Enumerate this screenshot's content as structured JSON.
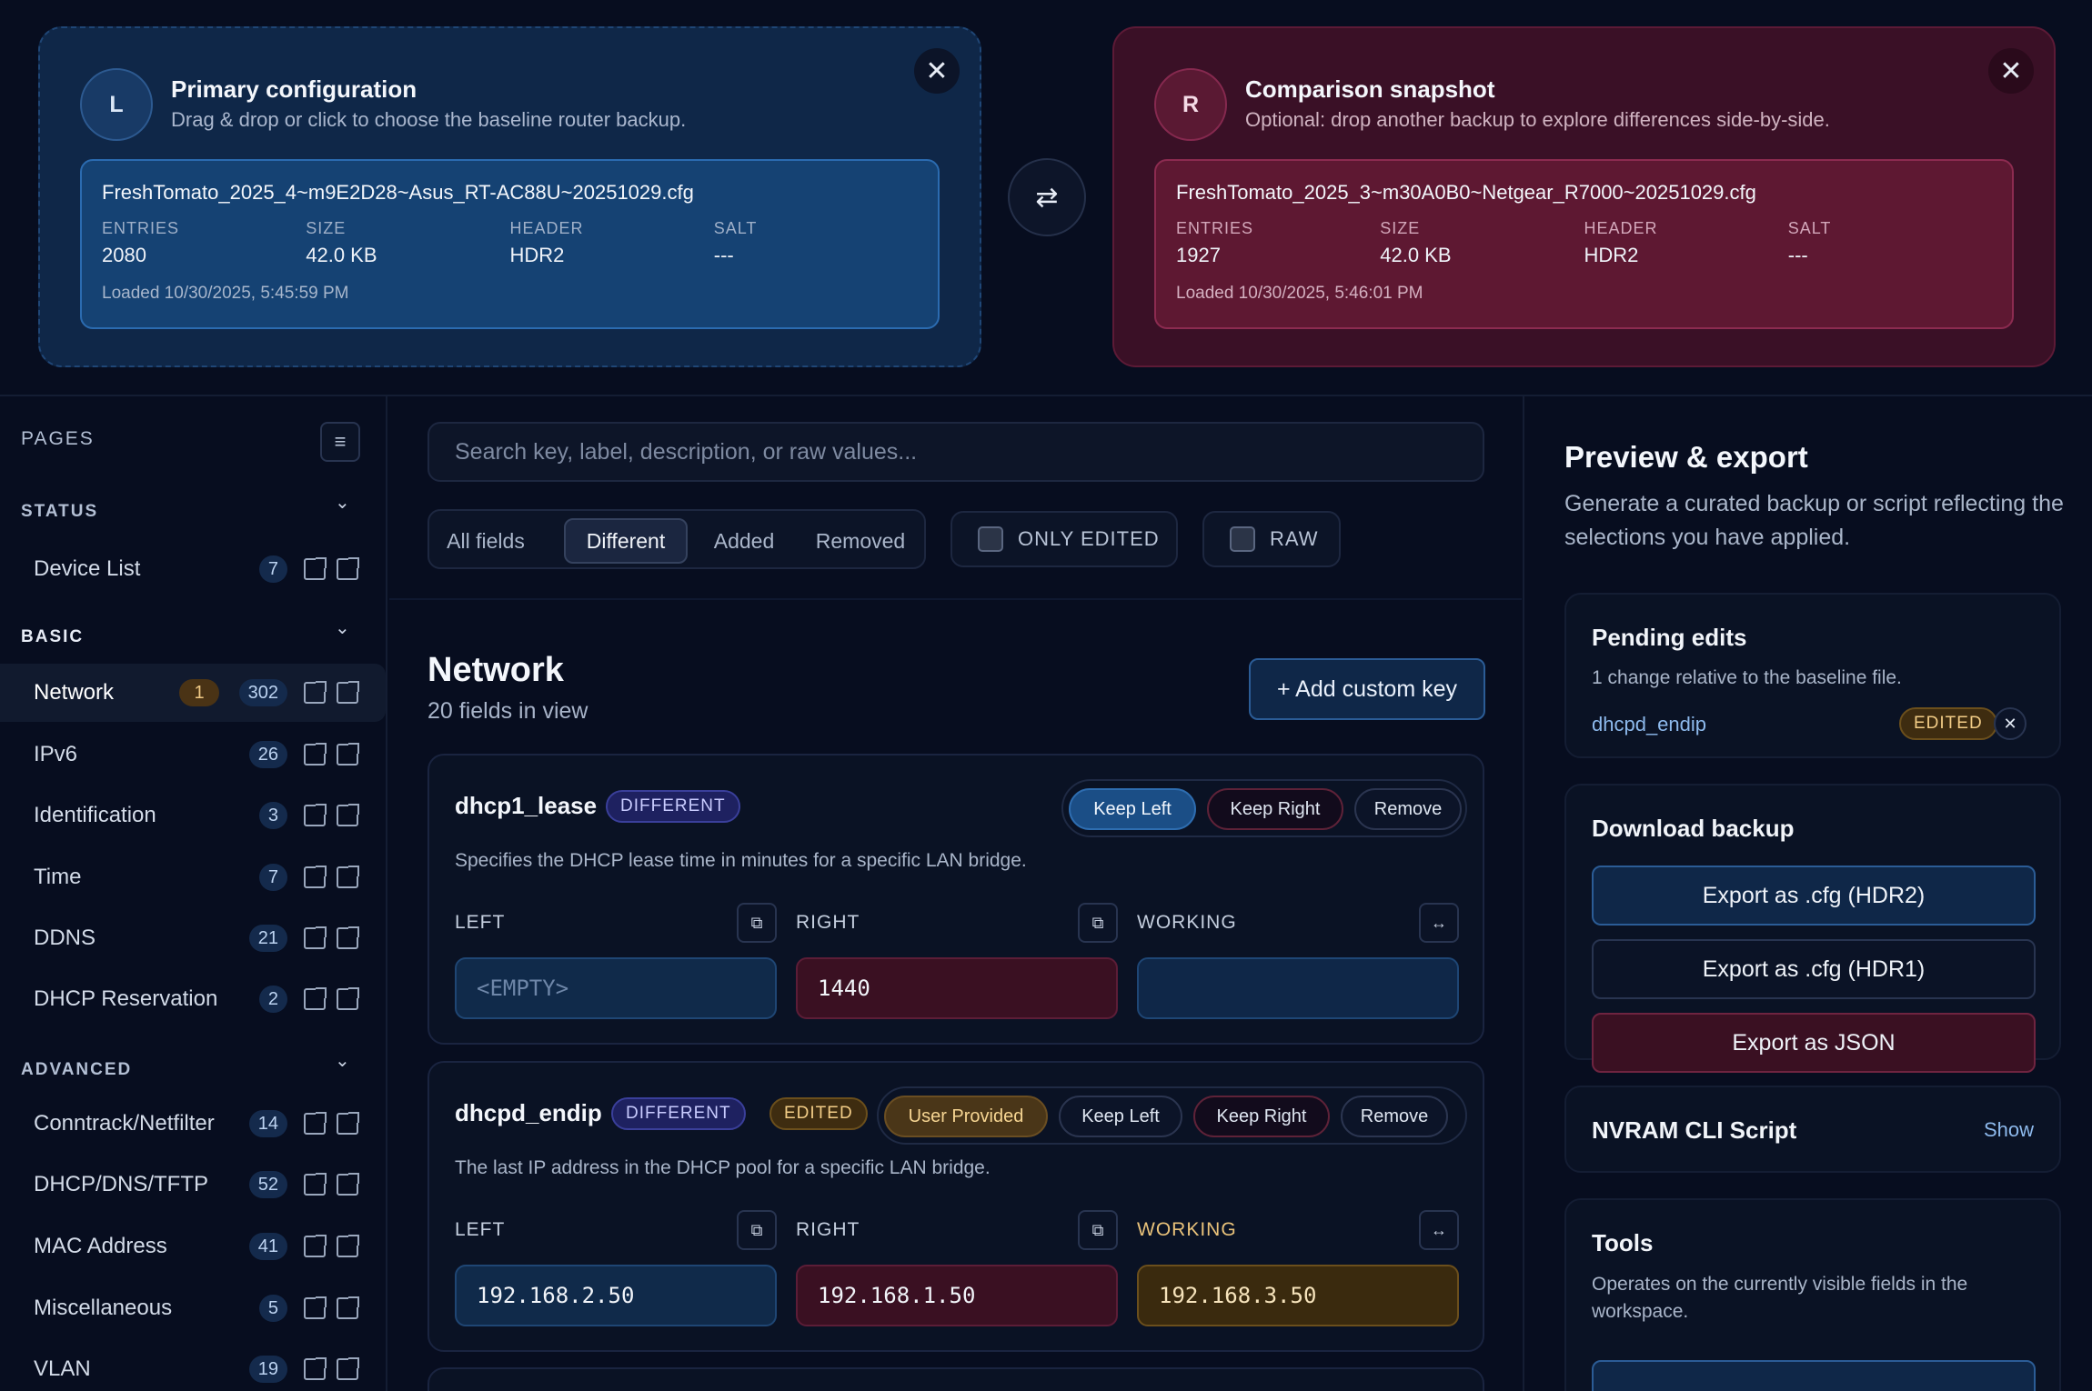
{
  "primary": {
    "avatar": "L",
    "title": "Primary configuration",
    "subtitle": "Drag & drop or click to choose the baseline router backup.",
    "file_name": "FreshTomato_2025_4~m9E2D28~Asus_RT-AC88U~20251029.cfg",
    "meta": [
      {
        "label": "ENTRIES",
        "value": "2080"
      },
      {
        "label": "SIZE",
        "value": "42.0 KB"
      },
      {
        "label": "HEADER",
        "value": "HDR2"
      },
      {
        "label": "SALT",
        "value": "---"
      }
    ],
    "loaded": "Loaded 10/30/2025, 5:45:59 PM"
  },
  "comparison": {
    "avatar": "R",
    "title": "Comparison snapshot",
    "subtitle": "Optional: drop another backup to explore differences side-by-side.",
    "file_name": "FreshTomato_2025_3~m30A0B0~Netgear_R7000~20251029.cfg",
    "meta": [
      {
        "label": "ENTRIES",
        "value": "1927"
      },
      {
        "label": "SIZE",
        "value": "42.0 KB"
      },
      {
        "label": "HEADER",
        "value": "HDR2"
      },
      {
        "label": "SALT",
        "value": "---"
      }
    ],
    "loaded": "Loaded 10/30/2025, 5:46:01 PM"
  },
  "icons": {
    "close": "✕",
    "swap": "⇄",
    "menu": "≡",
    "chevron": "⌄",
    "copy": "⧉",
    "swap_small": "↔"
  },
  "sidebar": {
    "pages_label": "PAGES",
    "sections": [
      {
        "title": "STATUS",
        "color": "#b3bfd4"
      },
      {
        "title": "BASIC",
        "color": "#e6ebf5"
      },
      {
        "title": "ADVANCED",
        "color": "#b3bfd4"
      }
    ],
    "items": [
      {
        "label": "Device List",
        "count": "7"
      },
      {
        "label": "Network",
        "count": "302",
        "edited": "1"
      },
      {
        "label": "IPv6",
        "count": "26"
      },
      {
        "label": "Identification",
        "count": "3"
      },
      {
        "label": "Time",
        "count": "7"
      },
      {
        "label": "DDNS",
        "count": "21"
      },
      {
        "label": "DHCP Reservation",
        "count": "2"
      },
      {
        "label": "Conntrack/Netfilter",
        "count": "14"
      },
      {
        "label": "DHCP/DNS/TFTP",
        "count": "52"
      },
      {
        "label": "MAC Address",
        "count": "41"
      },
      {
        "label": "Miscellaneous",
        "count": "5"
      },
      {
        "label": "VLAN",
        "count": "19"
      }
    ]
  },
  "main": {
    "search_placeholder": "Search key, label, description, or raw values...",
    "filters": [
      "All fields",
      "Different",
      "Added",
      "Removed"
    ],
    "toggles": [
      "ONLY EDITED",
      "RAW"
    ],
    "section_title": "Network",
    "section_sub": "20 fields in view",
    "add_key": "+ Add custom key",
    "columns": {
      "left": "LEFT",
      "right": "RIGHT",
      "working": "WORKING"
    },
    "fields": [
      {
        "key": "dhcp1_lease",
        "badge": "DIFFERENT",
        "description": "Specifies the DHCP lease time in minutes for a specific LAN bridge.",
        "actions": [
          "Keep Left",
          "Keep Right",
          "Remove"
        ],
        "left": "<EMPTY>",
        "right": "1440",
        "working": ""
      },
      {
        "key": "dhcpd_endip",
        "badge": "DIFFERENT",
        "edited_badge": "EDITED",
        "description": "The last IP address in the DHCP pool for a specific LAN bridge.",
        "actions": [
          "User Provided",
          "Keep Left",
          "Keep Right",
          "Remove"
        ],
        "left": "192.168.2.50",
        "right": "192.168.1.50",
        "working": "192.168.3.50"
      }
    ]
  },
  "preview": {
    "title": "Preview & export",
    "subtitle": "Generate a curated backup or script reflecting the selections you have applied.",
    "pending": {
      "title": "Pending edits",
      "subtitle": "1 change relative to the baseline file.",
      "key": "dhcpd_endip",
      "badge": "EDITED"
    },
    "download": {
      "title": "Download backup",
      "buttons": [
        "Export as .cfg (HDR2)",
        "Export as .cfg (HDR1)",
        "Export as JSON"
      ]
    },
    "cli": {
      "title": "NVRAM CLI Script",
      "show": "Show"
    },
    "tools": {
      "title": "Tools",
      "subtitle": "Operates on the currently visible fields in the workspace."
    }
  }
}
